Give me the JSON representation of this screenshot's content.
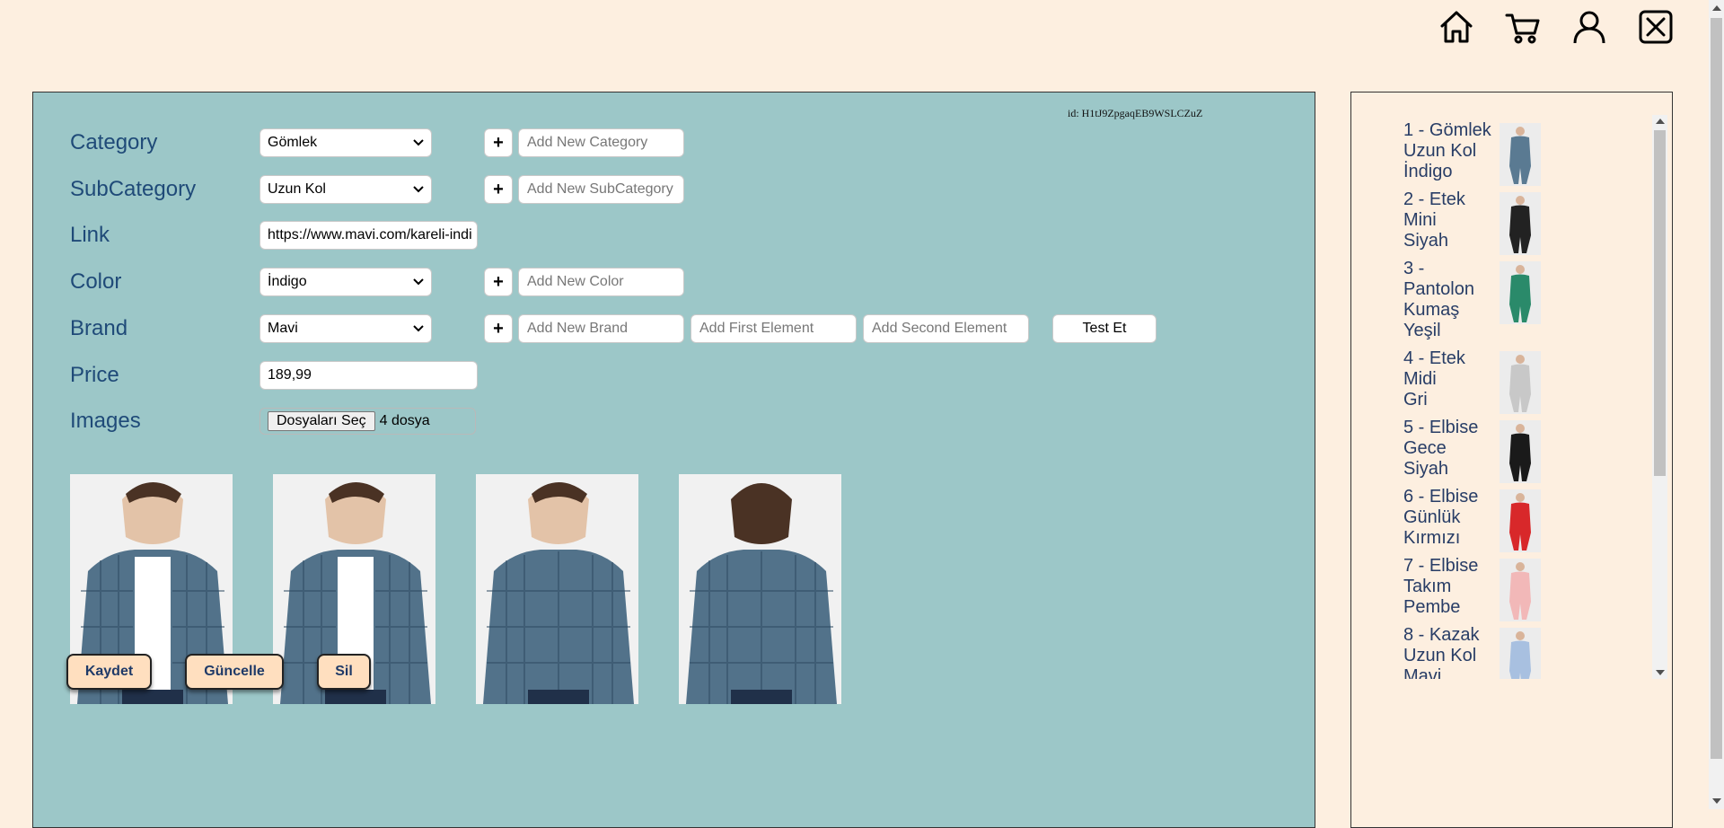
{
  "nav": {
    "icons": [
      "home-icon",
      "cart-icon",
      "user-icon",
      "close-icon"
    ]
  },
  "form": {
    "record_id": "id: H1tJ9ZpgaqEB9WSLCZuZ",
    "category": {
      "label": "Category",
      "value": "Gömlek",
      "placeholder": "Add New Category"
    },
    "subcategory": {
      "label": "SubCategory",
      "value": "Uzun Kol",
      "placeholder": "Add New SubCategory"
    },
    "link": {
      "label": "Link",
      "value": "https://www.mavi.com/kareli-indi"
    },
    "color": {
      "label": "Color",
      "value": "İndigo",
      "placeholder": "Add New Color"
    },
    "brand": {
      "label": "Brand",
      "value": "Mavi",
      "placeholder": "Add New Brand",
      "first_placeholder": "Add First Element",
      "second_placeholder": "Add Second Element",
      "test_label": "Test Et"
    },
    "price": {
      "label": "Price",
      "value": "189,99"
    },
    "images": {
      "label": "Images",
      "button_label": "Dosyaları Seç",
      "count_text": "4 dosya"
    },
    "plus_label": "+"
  },
  "actions": {
    "save": "Kaydet",
    "update": "Güncelle",
    "delete": "Sil"
  },
  "sidebar": {
    "items": [
      {
        "lines": [
          "1 - Gömlek",
          "Uzun Kol",
          "İndigo"
        ],
        "thumb": "shirt-plaid"
      },
      {
        "lines": [
          "2 - Etek",
          "Mini",
          "Siyah"
        ],
        "thumb": "skirt-black"
      },
      {
        "lines": [
          "3 -",
          "Pantolon",
          "Kumaş",
          "Yeşil"
        ],
        "thumb": "pants-green"
      },
      {
        "lines": [
          "4 - Etek",
          "Midi",
          "Gri"
        ],
        "thumb": "skirt-gray"
      },
      {
        "lines": [
          "5 - Elbise",
          "Gece",
          "Siyah"
        ],
        "thumb": "dress-black"
      },
      {
        "lines": [
          "6 - Elbise",
          "Günlük",
          "Kırmızı"
        ],
        "thumb": "dress-red"
      },
      {
        "lines": [
          "7 - Elbise",
          "Takım",
          "Pembe"
        ],
        "thumb": "suit-pink"
      },
      {
        "lines": [
          "8 - Kazak",
          "Uzun Kol",
          "Mavi"
        ],
        "thumb": "sweater-blue"
      }
    ]
  },
  "colors": {
    "page_bg": "#fdefe0",
    "panel_bg": "#9cc7c8",
    "label": "#1f4a78",
    "button_bg": "#ffdfbf",
    "button_text": "#1f3a68",
    "sidebar_text": "#283d66"
  }
}
